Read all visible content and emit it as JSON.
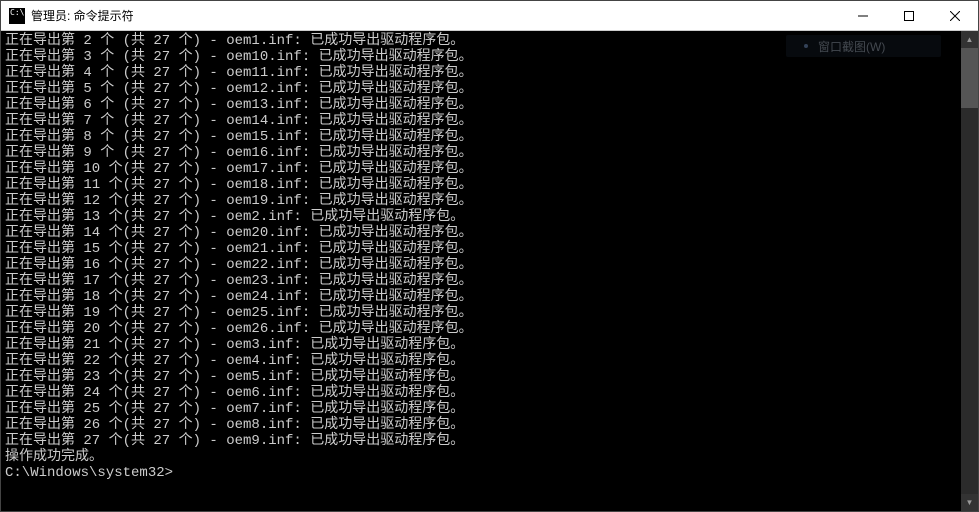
{
  "titlebar": {
    "title": "管理员: 命令提示符"
  },
  "ghost_menu": {
    "label": "窗口截图(W)"
  },
  "console": {
    "lines": [
      "正在导出第 2 个 (共 27 个) - oem1.inf: 已成功导出驱动程序包。",
      "正在导出第 3 个 (共 27 个) - oem10.inf: 已成功导出驱动程序包。",
      "正在导出第 4 个 (共 27 个) - oem11.inf: 已成功导出驱动程序包。",
      "正在导出第 5 个 (共 27 个) - oem12.inf: 已成功导出驱动程序包。",
      "正在导出第 6 个 (共 27 个) - oem13.inf: 已成功导出驱动程序包。",
      "正在导出第 7 个 (共 27 个) - oem14.inf: 已成功导出驱动程序包。",
      "正在导出第 8 个 (共 27 个) - oem15.inf: 已成功导出驱动程序包。",
      "正在导出第 9 个 (共 27 个) - oem16.inf: 已成功导出驱动程序包。",
      "正在导出第 10 个(共 27 个) - oem17.inf: 已成功导出驱动程序包。",
      "正在导出第 11 个(共 27 个) - oem18.inf: 已成功导出驱动程序包。",
      "正在导出第 12 个(共 27 个) - oem19.inf: 已成功导出驱动程序包。",
      "正在导出第 13 个(共 27 个) - oem2.inf: 已成功导出驱动程序包。",
      "正在导出第 14 个(共 27 个) - oem20.inf: 已成功导出驱动程序包。",
      "正在导出第 15 个(共 27 个) - oem21.inf: 已成功导出驱动程序包。",
      "正在导出第 16 个(共 27 个) - oem22.inf: 已成功导出驱动程序包。",
      "正在导出第 17 个(共 27 个) - oem23.inf: 已成功导出驱动程序包。",
      "正在导出第 18 个(共 27 个) - oem24.inf: 已成功导出驱动程序包。",
      "正在导出第 19 个(共 27 个) - oem25.inf: 已成功导出驱动程序包。",
      "正在导出第 20 个(共 27 个) - oem26.inf: 已成功导出驱动程序包。",
      "正在导出第 21 个(共 27 个) - oem3.inf: 已成功导出驱动程序包。",
      "正在导出第 22 个(共 27 个) - oem4.inf: 已成功导出驱动程序包。",
      "正在导出第 23 个(共 27 个) - oem5.inf: 已成功导出驱动程序包。",
      "正在导出第 24 个(共 27 个) - oem6.inf: 已成功导出驱动程序包。",
      "正在导出第 25 个(共 27 个) - oem7.inf: 已成功导出驱动程序包。",
      "正在导出第 26 个(共 27 个) - oem8.inf: 已成功导出驱动程序包。",
      "正在导出第 27 个(共 27 个) - oem9.inf: 已成功导出驱动程序包。",
      "操作成功完成。",
      "",
      "C:\\Windows\\system32>"
    ]
  }
}
